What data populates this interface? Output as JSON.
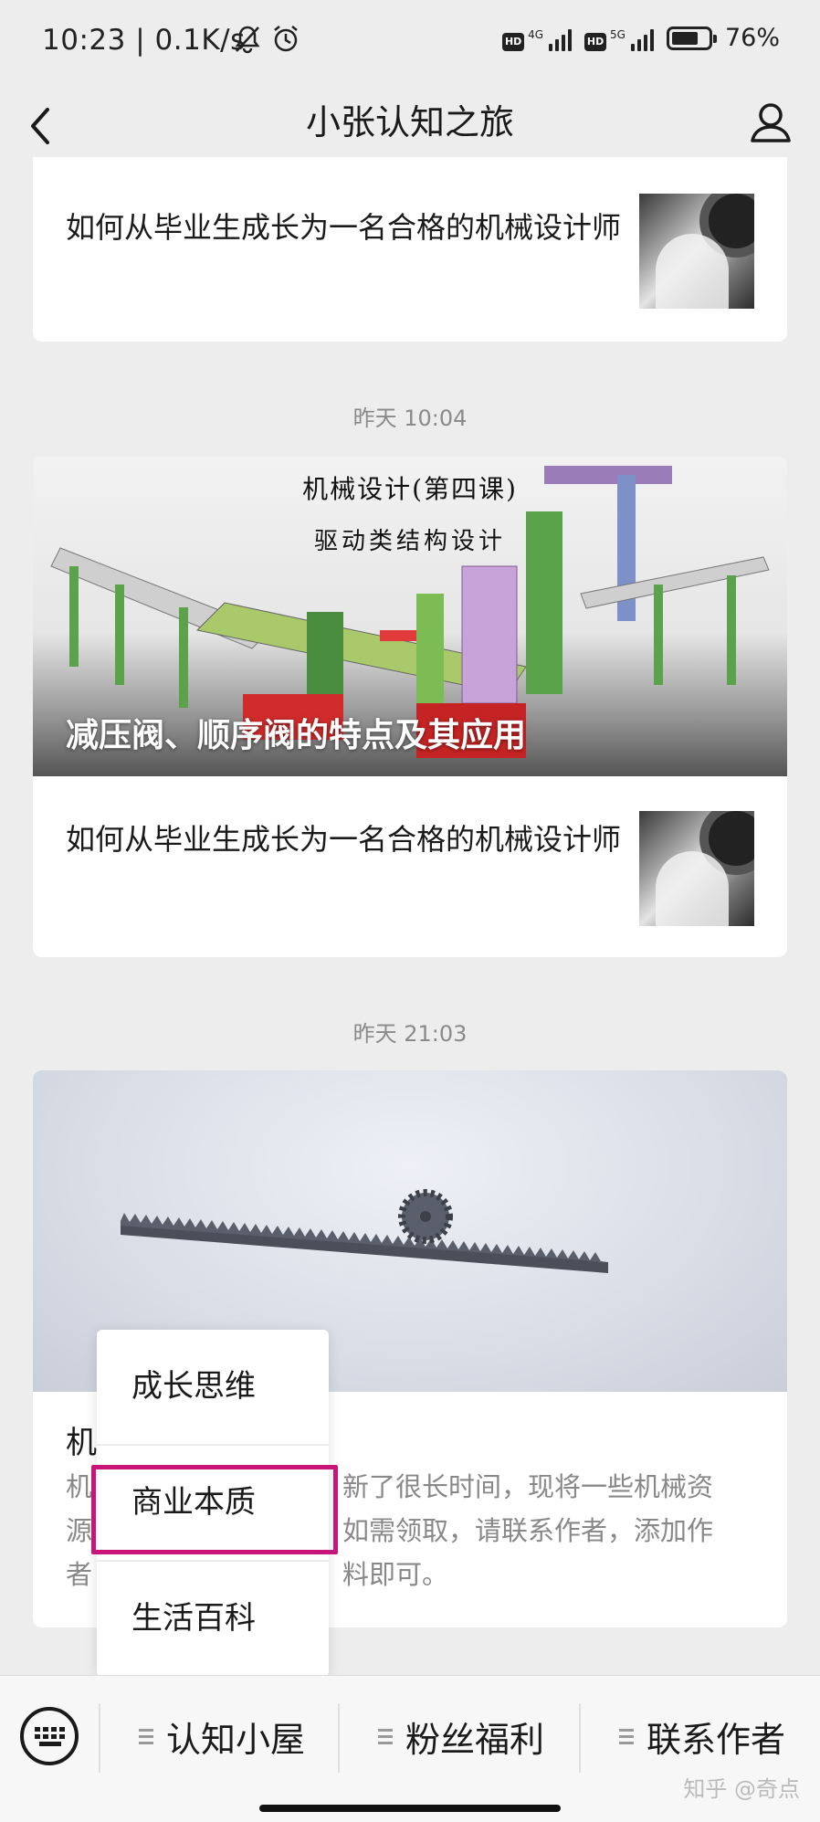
{
  "status_bar": {
    "time": "10:23",
    "speed": "0.1K/s",
    "network1": "4G",
    "network2": "5G",
    "hd": "HD",
    "battery": "76%",
    "icons": [
      "mute-bell-icon",
      "alarm-clock-icon",
      "signal-icon",
      "battery-icon"
    ]
  },
  "header": {
    "title": "小张认知之旅",
    "back_icon": "chevron-left-icon",
    "profile_icon": "person-icon"
  },
  "feed": {
    "first_card": {
      "article_title": "如何从毕业生成长为一名合格的机械设计师"
    },
    "group2": {
      "time": "昨天 10:04",
      "cover_headline_1": "机械设计(第四课)",
      "cover_headline_2": "驱动类结构设计",
      "cover_title": "减压阀、顺序阀的特点及其应用",
      "article_title": "如何从毕业生成长为一名合格的机械设计师"
    },
    "group3": {
      "time": "昨天 21:03",
      "title_visible": "机",
      "desc_line1_left": "机",
      "desc_line1_right": "新了很长时间，现将一些机械资",
      "desc_line2_left": "源",
      "desc_line2_right": "如需领取，请联系作者，添加作",
      "desc_line3_left": "者",
      "desc_line3_right": "料即可。"
    }
  },
  "popup_menu": {
    "items": [
      {
        "label": "成长思维"
      },
      {
        "label": "商业本质"
      },
      {
        "label": "生活百科"
      }
    ],
    "highlight_color": "#c8157a"
  },
  "bottom_bar": {
    "keyboard_icon": "keyboard-icon",
    "tabs": [
      {
        "label": "认知小屋"
      },
      {
        "label": "粉丝福利"
      },
      {
        "label": "联系作者"
      }
    ],
    "watermark": "知乎 @奇点"
  }
}
